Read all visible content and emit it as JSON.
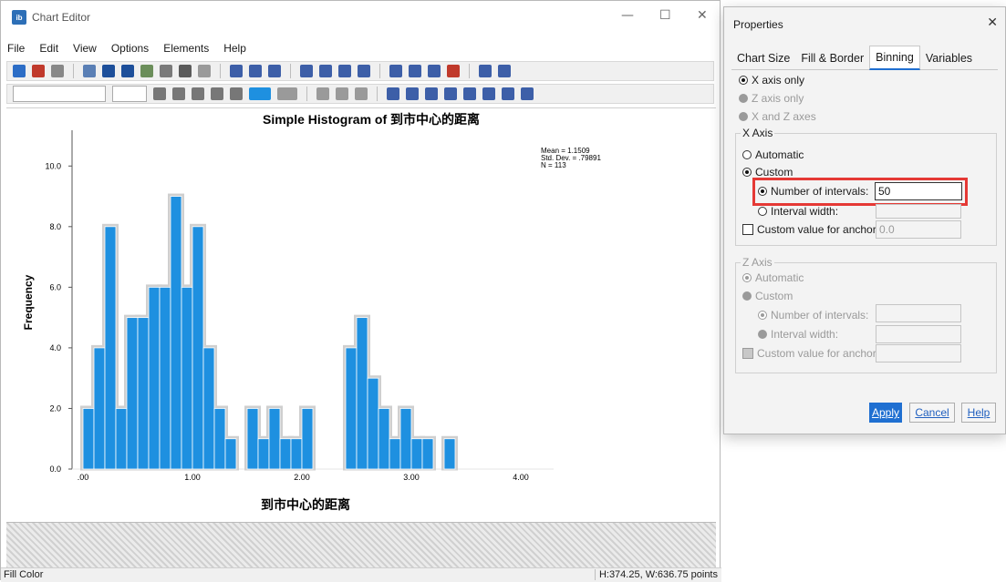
{
  "chart_editor": {
    "title": "Chart Editor",
    "menus": [
      "File",
      "Edit",
      "View",
      "Options",
      "Elements",
      "Help"
    ],
    "status_left": "Fill Color",
    "status_right": "H:374.25, W:636.75 points"
  },
  "properties": {
    "title": "Properties",
    "tabs": [
      "Chart Size",
      "Fill & Border",
      "Binning",
      "Variables"
    ],
    "active_tab": "Binning",
    "axis_options": [
      "X axis only",
      "Z axis only",
      "X and Z axes"
    ],
    "x_axis": {
      "label": "X Axis",
      "automatic": "Automatic",
      "custom": "Custom",
      "num_intervals_label": "Number of intervals:",
      "num_intervals_value": "50",
      "interval_width_label": "Interval width:",
      "anchor_label": "Custom value for anchor:",
      "anchor_value": "0.0"
    },
    "z_axis": {
      "label": "Z Axis",
      "automatic": "Automatic",
      "custom": "Custom",
      "num_intervals_label": "Number of intervals:",
      "interval_width_label": "Interval width:",
      "anchor_label": "Custom value for anchor:"
    },
    "buttons": {
      "apply": "Apply",
      "cancel": "Cancel",
      "help": "Help"
    }
  },
  "chart_data": {
    "type": "bar",
    "title": "Simple Histogram of 到市中心的距离",
    "xlabel": "到市中心的距离",
    "ylabel": "Frequency",
    "stats": [
      "Mean = 1.1509",
      "Std. Dev. = .79891",
      "N = 113"
    ],
    "xlim": [
      -0.1,
      4.3
    ],
    "ylim": [
      0,
      11
    ],
    "xticks": [
      0,
      1,
      2,
      3,
      4
    ],
    "xtick_labels": [
      ".00",
      "1.00",
      "2.00",
      "3.00",
      "4.00"
    ],
    "yticks": [
      0,
      2,
      4,
      6,
      8,
      10
    ],
    "ytick_labels": [
      "0.0",
      "2.0",
      "4.0",
      "6.0",
      "8.0",
      "10.0"
    ],
    "bin_width": 0.1,
    "bin_starts": [
      0.0,
      0.1,
      0.2,
      0.3,
      0.4,
      0.5,
      0.6,
      0.7,
      0.8,
      0.9,
      1.0,
      1.1,
      1.2,
      1.3,
      1.5,
      1.6,
      1.7,
      1.8,
      1.9,
      2.0,
      2.4,
      2.5,
      2.6,
      2.7,
      2.8,
      2.9,
      3.0,
      3.1,
      3.3
    ],
    "values": [
      2,
      4,
      8,
      2,
      5,
      5,
      6,
      6,
      9,
      6,
      8,
      4,
      2,
      1,
      2,
      1,
      2,
      1,
      1,
      2,
      4,
      5,
      3,
      2,
      1,
      2,
      1,
      1,
      1
    ],
    "bar_color": "#1e90e0"
  }
}
